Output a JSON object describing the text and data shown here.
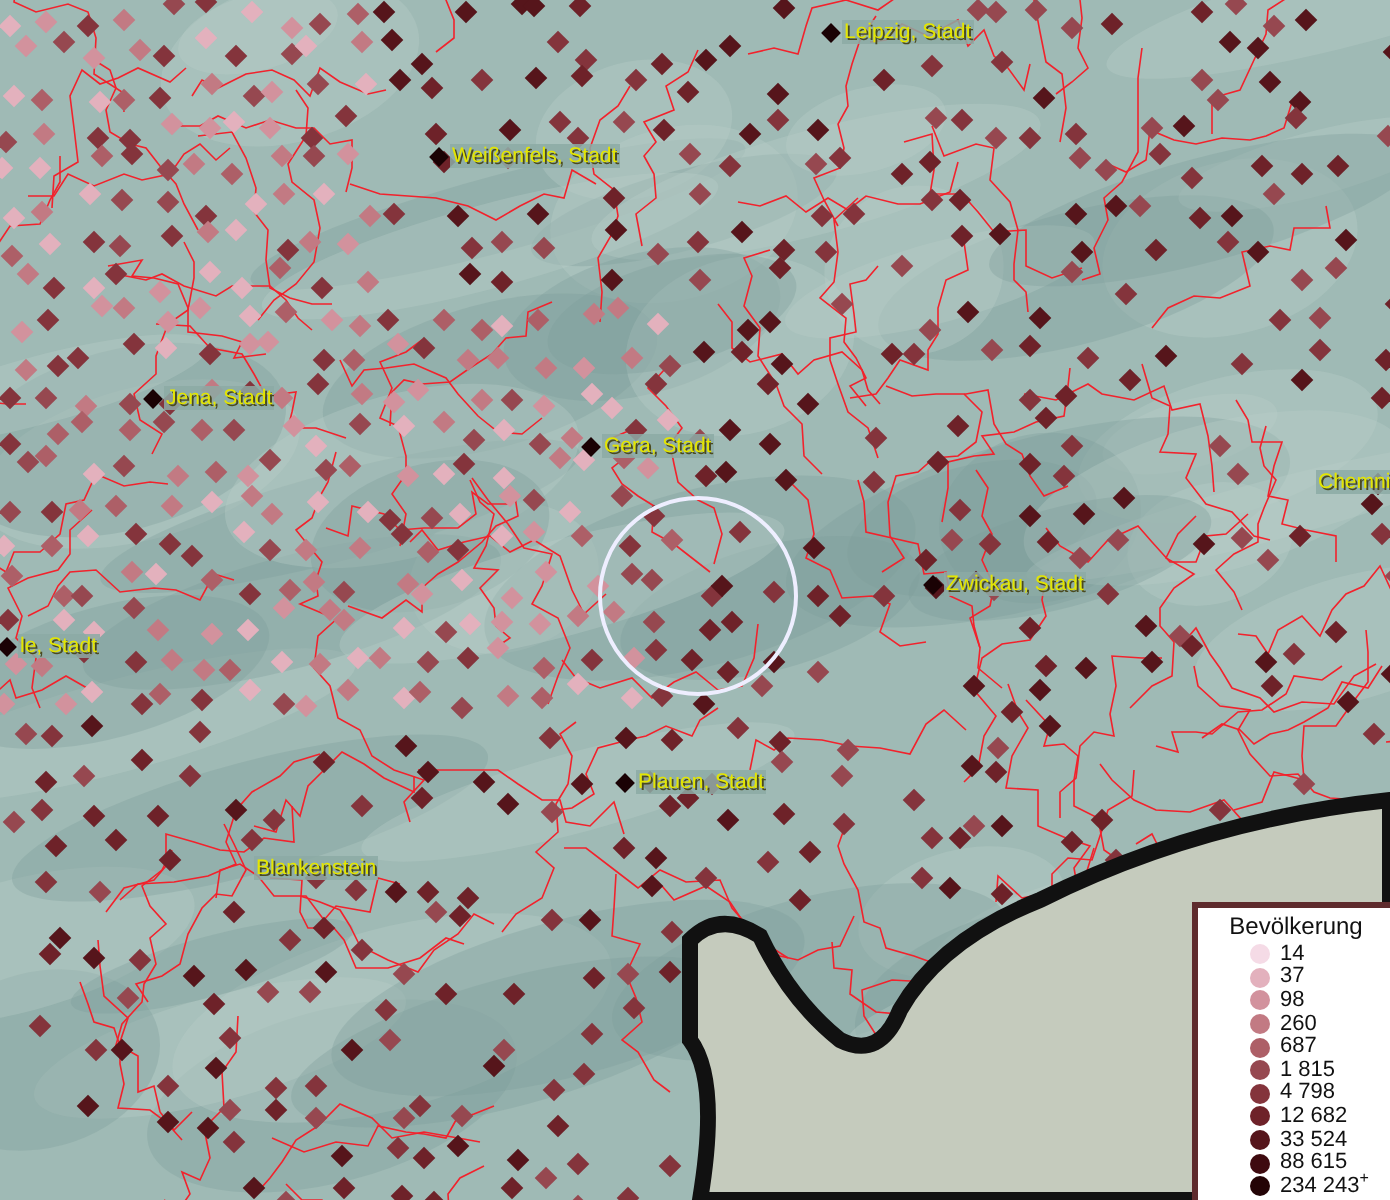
{
  "map": {
    "places": [
      {
        "label": "Leipzig, Stadt"
      },
      {
        "label": "Weißenfels, Stadt"
      },
      {
        "label": "Jena, Stadt"
      },
      {
        "label": "Gera, Stadt"
      },
      {
        "label": "Chemni"
      },
      {
        "label": "Zwickau, Stadt"
      },
      {
        "label": "le, Stadt"
      },
      {
        "label": "Plauen, Stadt"
      },
      {
        "label": "Blankenstein",
        "kind": "plain"
      }
    ]
  },
  "legend": {
    "title": "Bevölkerung",
    "items": [
      {
        "label": "14",
        "color": "#f5dbe6"
      },
      {
        "label": "37",
        "color": "#e3b1bd"
      },
      {
        "label": "98",
        "color": "#d2929d"
      },
      {
        "label": "260",
        "color": "#c27a83"
      },
      {
        "label": "687",
        "color": "#ad5f67"
      },
      {
        "label": "1 815",
        "color": "#964850"
      },
      {
        "label": "4 798",
        "color": "#84343c"
      },
      {
        "label": "12 682",
        "color": "#6e2229"
      },
      {
        "label": "33 524",
        "color": "#56151b"
      },
      {
        "label": "88 615",
        "color": "#3e0a0f"
      },
      {
        "label": "234 243$^{+}$",
        "color": "#240406"
      }
    ]
  }
}
